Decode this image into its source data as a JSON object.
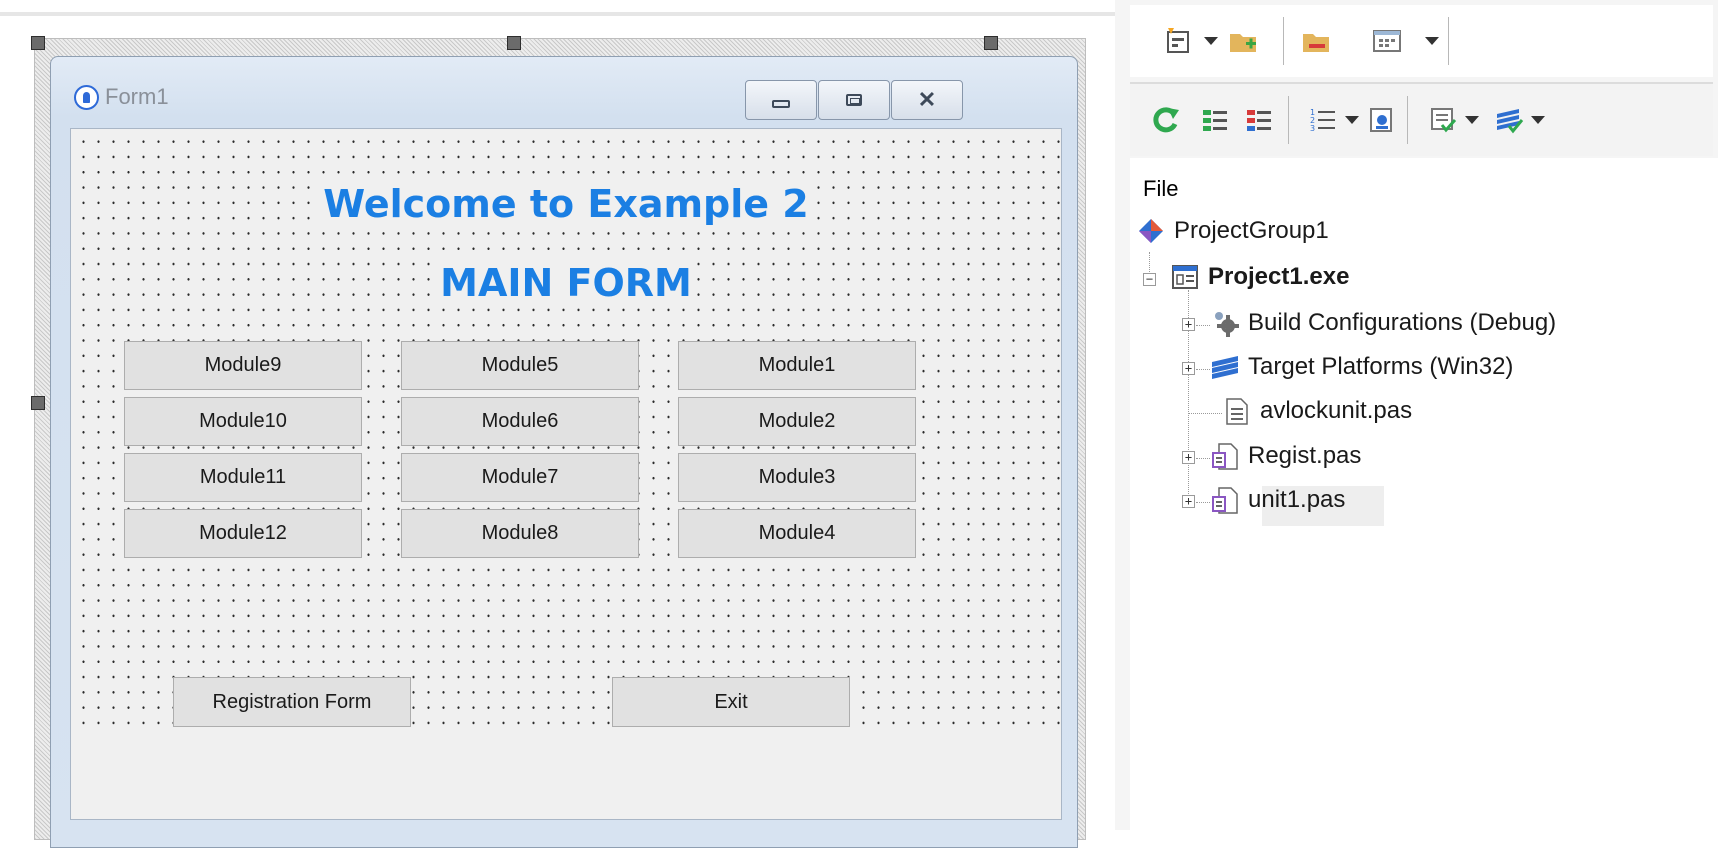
{
  "form": {
    "title": "Form1",
    "heading1": "Welcome to Example 2",
    "heading2": "MAIN FORM",
    "buttons": {
      "module9": "Module9",
      "module5": "Module5",
      "module1": "Module1",
      "module10": "Module10",
      "module6": "Module6",
      "module2": "Module2",
      "module11": "Module11",
      "module7": "Module7",
      "module3": "Module3",
      "module12": "Module12",
      "module8": "Module8",
      "module4": "Module4",
      "registration": "Registration Form",
      "exit": "Exit"
    }
  },
  "project_manager": {
    "section_label": "File",
    "nodes": {
      "group": "ProjectGroup1",
      "project": "Project1.exe",
      "build_configs": "Build Configurations (Debug)",
      "target_platforms": "Target Platforms (Win32)",
      "avlockunit": "avlockunit.pas",
      "regist": "Regist.pas",
      "unit1": "unit1.pas"
    }
  },
  "colors": {
    "heading": "#1b7fe3",
    "button_face": "#e1e1e1",
    "form_caption": "#d3e0ef"
  }
}
